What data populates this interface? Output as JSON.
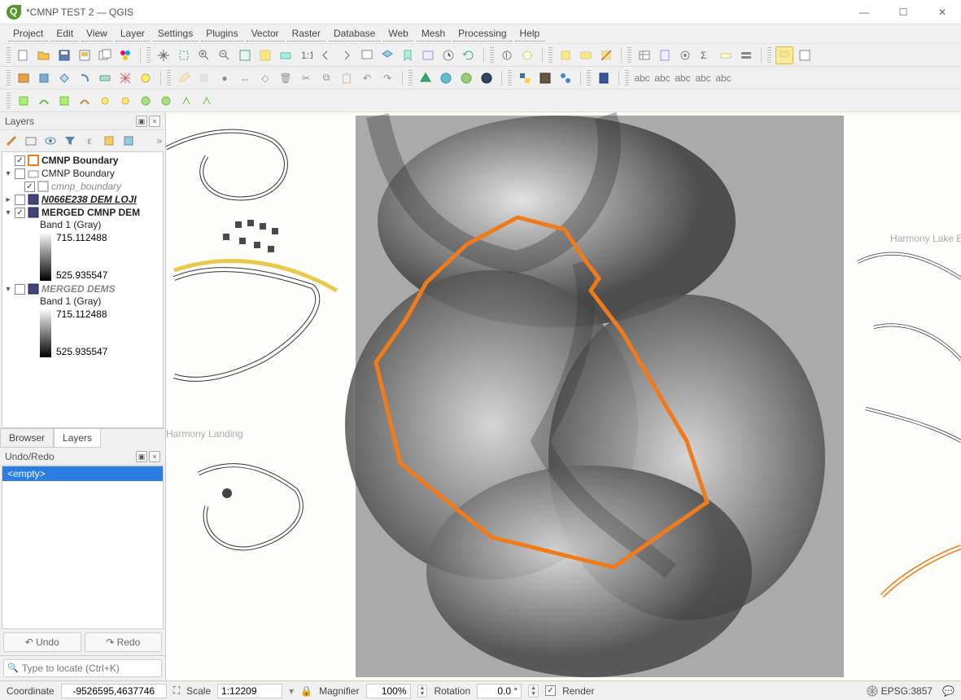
{
  "window": {
    "title": "*CMNP TEST 2 — QGIS"
  },
  "menu": [
    "Project",
    "Edit",
    "View",
    "Layer",
    "Settings",
    "Plugins",
    "Vector",
    "Raster",
    "Database",
    "Web",
    "Mesh",
    "Processing",
    "Help"
  ],
  "panels": {
    "layers_title": "Layers",
    "browser_tab": "Browser",
    "layers_tab": "Layers",
    "undo_title": "Undo/Redo",
    "undo_item": "<empty>",
    "undo_btn": "Undo",
    "redo_btn": "Redo"
  },
  "layers": {
    "n0": {
      "label": "CMNP Boundary"
    },
    "n1": {
      "label": "CMNP Boundary"
    },
    "n2": {
      "label": "cmnp_boundary"
    },
    "n3": {
      "label": "N066E238  DEM  LOJI"
    },
    "n4": {
      "label": "MERGED CMNP DEM"
    },
    "band1": "Band 1 (Gray)",
    "v_hi": "715.112488",
    "v_lo": "525.935547",
    "n5": {
      "label": "MERGED DEMS"
    }
  },
  "locator": {
    "placeholder": "Type to locate (Ctrl+K)"
  },
  "status": {
    "coord_label": "Coordinate",
    "coord_value": "-9526595,4637746",
    "scale_label": "Scale",
    "scale_value": "1:12209",
    "mag_label": "Magnifier",
    "mag_value": "100%",
    "rot_label": "Rotation",
    "rot_value": "0.0 °",
    "render_label": "Render",
    "epsg": "EPSG:3857"
  }
}
